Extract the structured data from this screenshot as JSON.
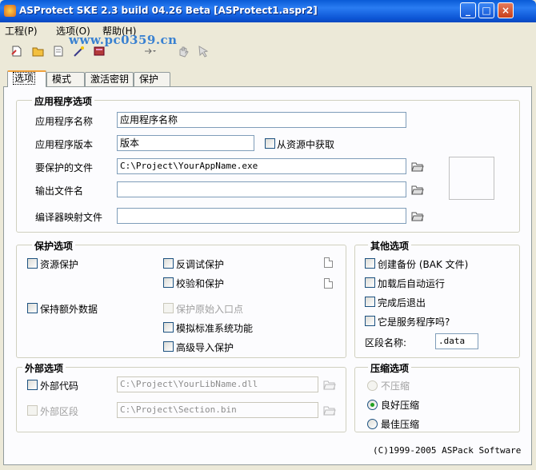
{
  "window": {
    "title": "ASProtect SKE 2.3 build 04.26 Beta [ASProtect1.aspr2]",
    "minimize": "_",
    "maximize": "□",
    "close": "×"
  },
  "menu": {
    "project": "工程(P)",
    "options": "选项(O)",
    "help": "帮助(H)"
  },
  "watermark": "www.pc0359.cn",
  "tabs": [
    {
      "label": "选项"
    },
    {
      "label": "模式"
    },
    {
      "label": "激活密钥"
    },
    {
      "label": "保护"
    }
  ],
  "app_options": {
    "title": "应用程序选项",
    "name_label": "应用程序名称",
    "name_value": "应用程序名称",
    "version_label": "应用程序版本",
    "version_value": "版本",
    "from_resource_label": "从资源中获取",
    "protect_file_label": "要保护的文件",
    "protect_file_value": "C:\\Project\\YourAppName.exe",
    "output_label": "输出文件名",
    "output_value": "",
    "map_label": "编译器映射文件",
    "map_value": ""
  },
  "protect_options": {
    "title": "保护选项",
    "resource_protect": "资源保护",
    "extra_data": "保持额外数据",
    "anti_debug": "反调试保护",
    "checksum": "校验和保护",
    "original_entry": "保护原始入口点",
    "emulate_std": "模拟标准系统功能",
    "advanced_import": "高级导入保护"
  },
  "other_options": {
    "title": "其他选项",
    "create_backup": "创建备份 (BAK 文件)",
    "auto_run": "加载后自动运行",
    "exit_after": "完成后退出",
    "is_service": "它是服务程序吗?",
    "section_name_label": "区段名称:",
    "section_name_value": ".data"
  },
  "external_options": {
    "title": "外部选项",
    "external_code": "外部代码",
    "external_code_path": "C:\\Project\\YourLibName.dll",
    "external_section": "外部区段",
    "external_section_path": "C:\\Project\\Section.bin"
  },
  "compression": {
    "title": "压缩选项",
    "none": "不压缩",
    "good": "良好压缩",
    "best": "最佳压缩",
    "selected": "良好压缩"
  },
  "copyright": "(C)1999-2005 ASPack Software",
  "colors": {
    "titlebar": "#0a5bd7",
    "tab_highlight": "#f1a23c",
    "radio_dot": "#21a121"
  }
}
